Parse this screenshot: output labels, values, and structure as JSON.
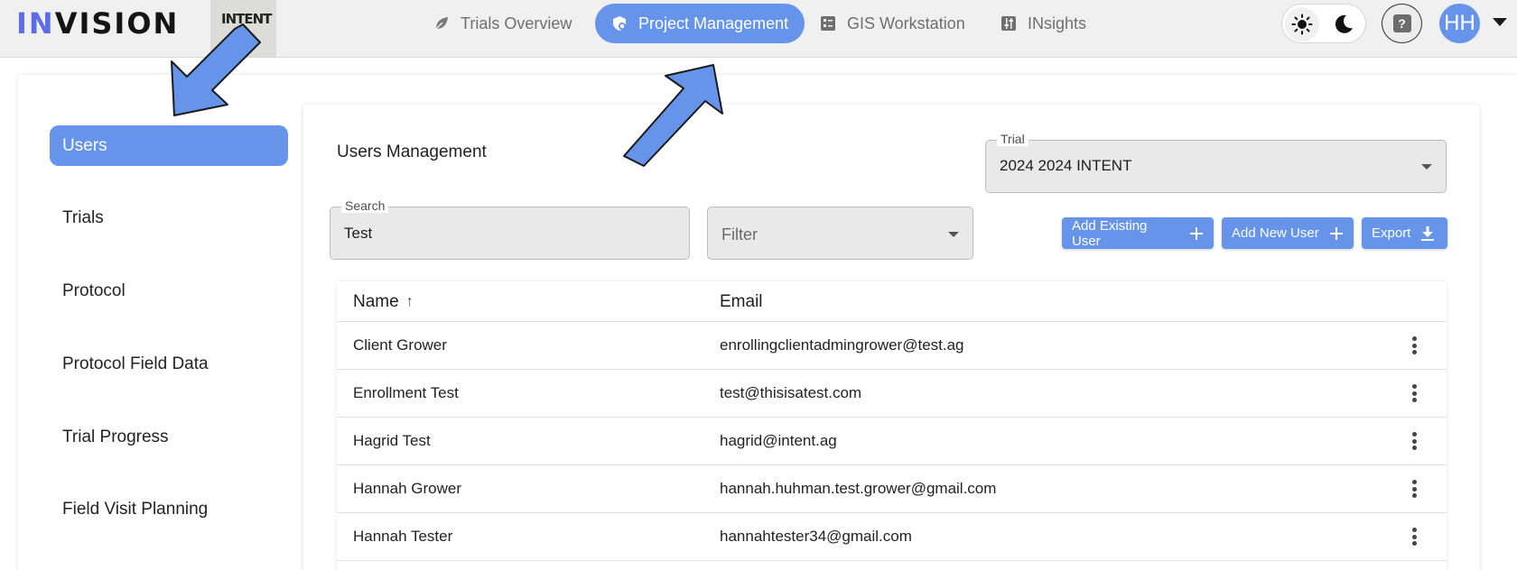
{
  "topbar": {
    "logo": {
      "part1": "IN",
      "part2": "VISION"
    },
    "brand_badge": "INTENT",
    "nav": [
      {
        "label": "Trials Overview",
        "icon": "leaf-icon",
        "active": false
      },
      {
        "label": "Project Management",
        "icon": "shield-gear-icon",
        "active": true
      },
      {
        "label": "GIS Workstation",
        "icon": "checklist-icon",
        "active": false
      },
      {
        "label": "INsights",
        "icon": "sliders-icon",
        "active": false
      }
    ],
    "help": "?",
    "avatar_initials": "HH"
  },
  "sidebar": {
    "items": [
      {
        "label": "Users",
        "active": true
      },
      {
        "label": "Trials",
        "active": false
      },
      {
        "label": "Protocol",
        "active": false
      },
      {
        "label": "Protocol Field Data",
        "active": false
      },
      {
        "label": "Trial Progress",
        "active": false
      },
      {
        "label": "Field Visit Planning",
        "active": false
      }
    ]
  },
  "main": {
    "title": "Users Management",
    "trial_select": {
      "label": "Trial",
      "value": "2024 2024 INTENT"
    },
    "search": {
      "label": "Search",
      "value": "Test"
    },
    "filter": {
      "placeholder": "Filter"
    },
    "buttons": {
      "add_existing": "Add Existing User",
      "add_new": "Add New User",
      "export": "Export"
    },
    "table": {
      "columns": {
        "name": "Name",
        "email": "Email"
      },
      "sort_indicator": "↑",
      "rows": [
        {
          "name": "Client Grower",
          "email": "enrollingclientadmingrower@test.ag"
        },
        {
          "name": "Enrollment Test",
          "email": "test@thisisatest.com"
        },
        {
          "name": "Hagrid Test",
          "email": "hagrid@intent.ag"
        },
        {
          "name": "Hannah Grower",
          "email": "hannah.huhman.test.grower@gmail.com"
        },
        {
          "name": "Hannah Tester",
          "email": "hannahtester34@gmail.com"
        }
      ]
    }
  },
  "colors": {
    "accent": "#6594ea",
    "annotation_arrow": "#6594ea"
  }
}
